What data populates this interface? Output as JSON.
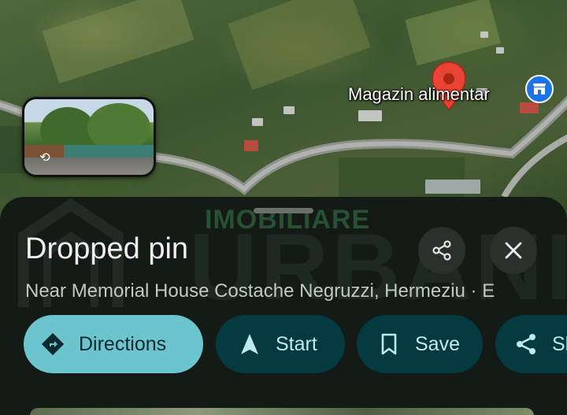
{
  "map": {
    "place_label": "Magazin alimentar",
    "pin_color": "#ea4335",
    "shop_badge_color": "#1a73e8",
    "street_view_icon": "panorama-360-icon",
    "shop_icon": "store-icon"
  },
  "watermark": {
    "subtitle": "IMOBILIARE",
    "main": "URBANIA"
  },
  "sheet": {
    "title": "Dropped pin",
    "subtitle": "Near Memorial House Costache Negruzzi, Hermeziu · E",
    "share_icon": "share-icon",
    "close_icon": "close-icon"
  },
  "actions": [
    {
      "label": "Directions",
      "icon": "directions-icon"
    },
    {
      "label": "Start",
      "icon": "navigation-arrow-icon"
    },
    {
      "label": "Save",
      "icon": "bookmark-icon"
    },
    {
      "label": "Sh",
      "icon": "share-icon"
    }
  ],
  "colors": {
    "directions_bg": "#6cc4cf",
    "chip_bg": "#053a40",
    "sheet_bg": "#141a16"
  }
}
